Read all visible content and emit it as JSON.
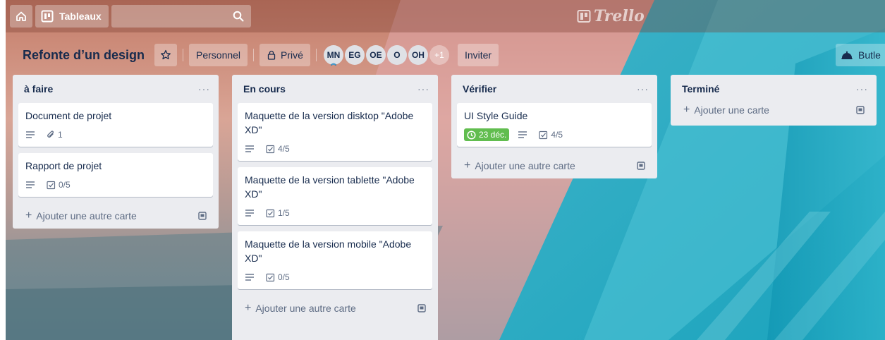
{
  "topbar": {
    "boards_label": "Tableaux",
    "logo_text": "Trello"
  },
  "board": {
    "title": "Refonte d’un design",
    "visibility_team": "Personnel",
    "visibility": "Privé",
    "members": [
      "MN",
      "EG",
      "OE",
      "O",
      "OH"
    ],
    "members_more": "+1",
    "invite_label": "Inviter",
    "butler_label": "Butle"
  },
  "lists": [
    {
      "title": "à faire",
      "menu": "···",
      "add_label": "Ajouter une autre carte",
      "cards": [
        {
          "title": "Document de projet",
          "description": true,
          "attachments": "1"
        },
        {
          "title": "Rapport de projet",
          "description": true,
          "checklist": "0/5"
        }
      ]
    },
    {
      "title": "En cours",
      "menu": "···",
      "add_label": "Ajouter une autre carte",
      "cards": [
        {
          "title": "Maquette de la version disktop \"Adobe XD\"",
          "description": true,
          "checklist": "4/5"
        },
        {
          "title": "Maquette de la version tablette \"Adobe XD\"",
          "description": true,
          "checklist": "1/5"
        },
        {
          "title": "Maquette de la version mobile \"Adobe XD\"",
          "description": true,
          "checklist": "0/5"
        }
      ]
    },
    {
      "title": "Vérifier",
      "menu": "···",
      "add_label": "Ajouter une autre carte",
      "cards": [
        {
          "title": "UI Style Guide",
          "due": "23 déc.",
          "description": true,
          "checklist": "4/5"
        }
      ]
    },
    {
      "title": "Terminé",
      "menu": "···",
      "add_label": "Ajouter une carte",
      "cards": []
    }
  ],
  "colors": {
    "due_complete": "#61bd4f",
    "list_bg": "#ebecf0",
    "text": "#172b4d"
  }
}
